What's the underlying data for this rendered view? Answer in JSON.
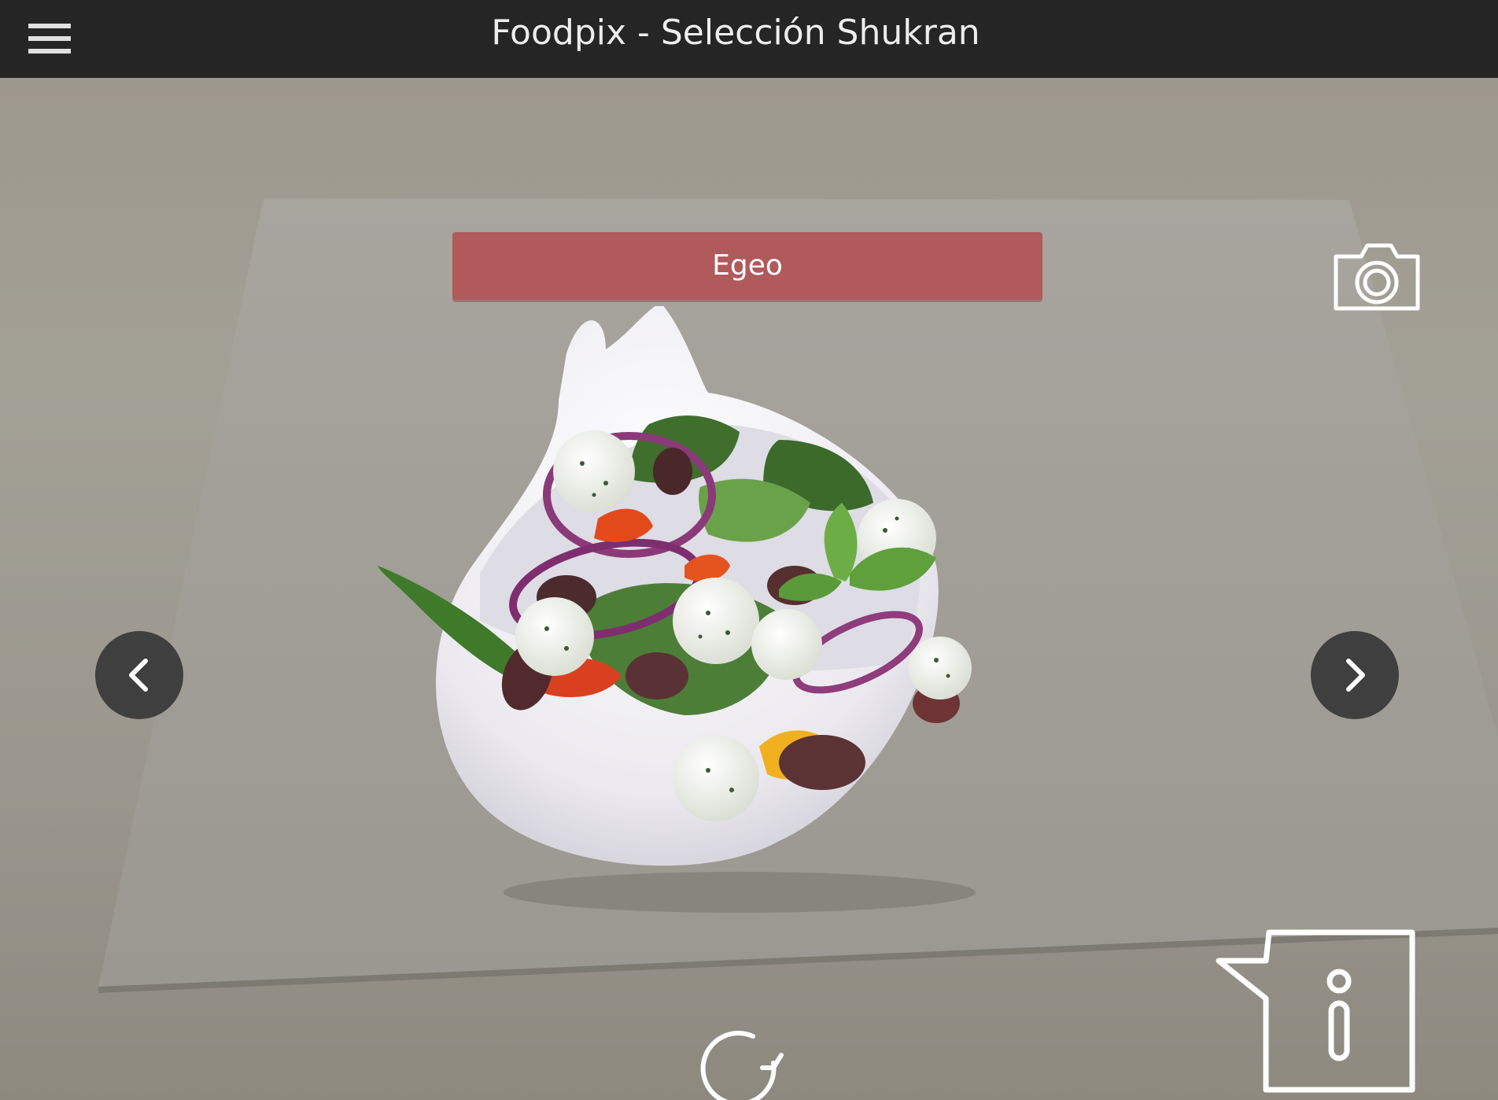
{
  "app_bar": {
    "title": "Foodpix - Selección Shukran",
    "menu_icon": "hamburger-menu-icon"
  },
  "viewer": {
    "dish_name": "Egeo",
    "dish_image": "greek-salad-bowl",
    "banner_color": "#b05a5c",
    "camera_icon": "camera-icon",
    "previous_icon": "chevron-left-icon",
    "next_icon": "chevron-right-icon",
    "rotate_icon": "rotate-icon",
    "info_icon": "info-speech-bubble-icon"
  }
}
